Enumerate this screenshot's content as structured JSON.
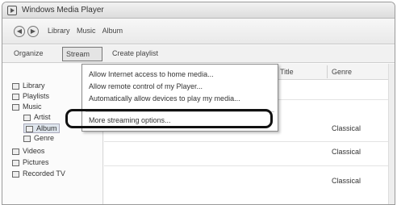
{
  "window": {
    "title": "Windows Media Player"
  },
  "nav": {
    "breadcrumb": [
      "Library",
      "Music",
      "Album"
    ]
  },
  "toolbar": {
    "organize": "Organize",
    "stream": "Stream",
    "create_playlist": "Create playlist"
  },
  "sidebar": {
    "items": [
      "Library",
      "Playlists",
      "Music",
      "Artist",
      "Album",
      "Genre",
      "Videos",
      "Pictures",
      "Recorded TV"
    ]
  },
  "table": {
    "columns": [
      "#",
      "Title",
      "Genre"
    ],
    "rows": [
      [
        "",
        "",
        "Classical"
      ],
      [
        "",
        "",
        "Classical"
      ],
      [
        "",
        "",
        "Classical"
      ]
    ]
  },
  "stream_menu": {
    "items": [
      "Allow Internet access to home media...",
      "Allow remote control of my Player...",
      "Automatically allow devices to play my media...",
      "More streaming options..."
    ]
  }
}
